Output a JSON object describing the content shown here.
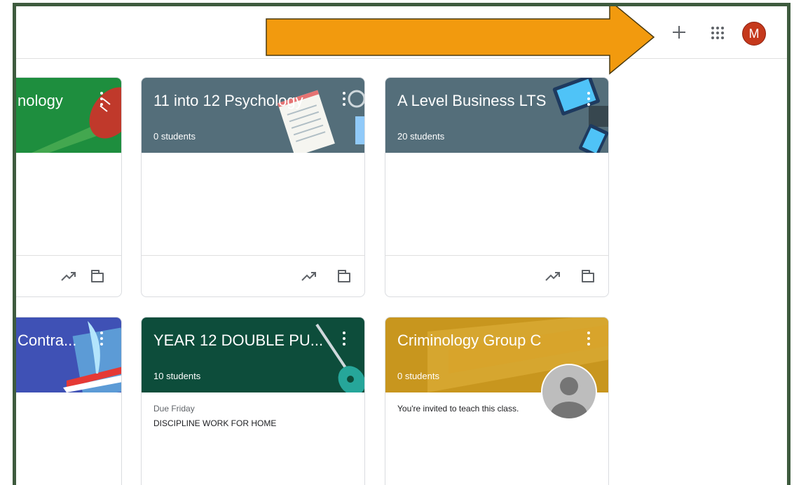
{
  "topbar": {
    "add_icon": "plus-icon",
    "apps_icon": "apps-grid-icon",
    "avatar_initial": "M",
    "avatar_color": "#c5391c"
  },
  "classes": [
    {
      "title": "nology",
      "students": "",
      "color": "#1e8e3e",
      "stat_icon": "trending-icon",
      "folder_icon": "folder-icon"
    },
    {
      "title": "11 into 12 Psychology",
      "students": "0 students",
      "color": "#546e7a",
      "stat_icon": "trending-icon",
      "folder_icon": "folder-icon"
    },
    {
      "title": "A Level Business LTS",
      "students": "20 students",
      "color": "#546e7a",
      "stat_icon": "trending-icon",
      "folder_icon": "folder-icon"
    },
    {
      "title": "Contra...",
      "students": "",
      "color": "#3f51b5"
    },
    {
      "title": "YEAR 12 DOUBLE PU...",
      "students": "10 students",
      "color": "#0d4d3b",
      "due_label": "Due Friday",
      "assignment": "DISCIPLINE WORK FOR HOME"
    },
    {
      "title": "Criminology Group C",
      "students": "0 students",
      "color": "#c8961e",
      "invite_text": "You're invited to teach this class."
    }
  ],
  "annotation": {
    "arrow_color": "#f29a0e",
    "arrow_stroke": "#4a3a10"
  }
}
